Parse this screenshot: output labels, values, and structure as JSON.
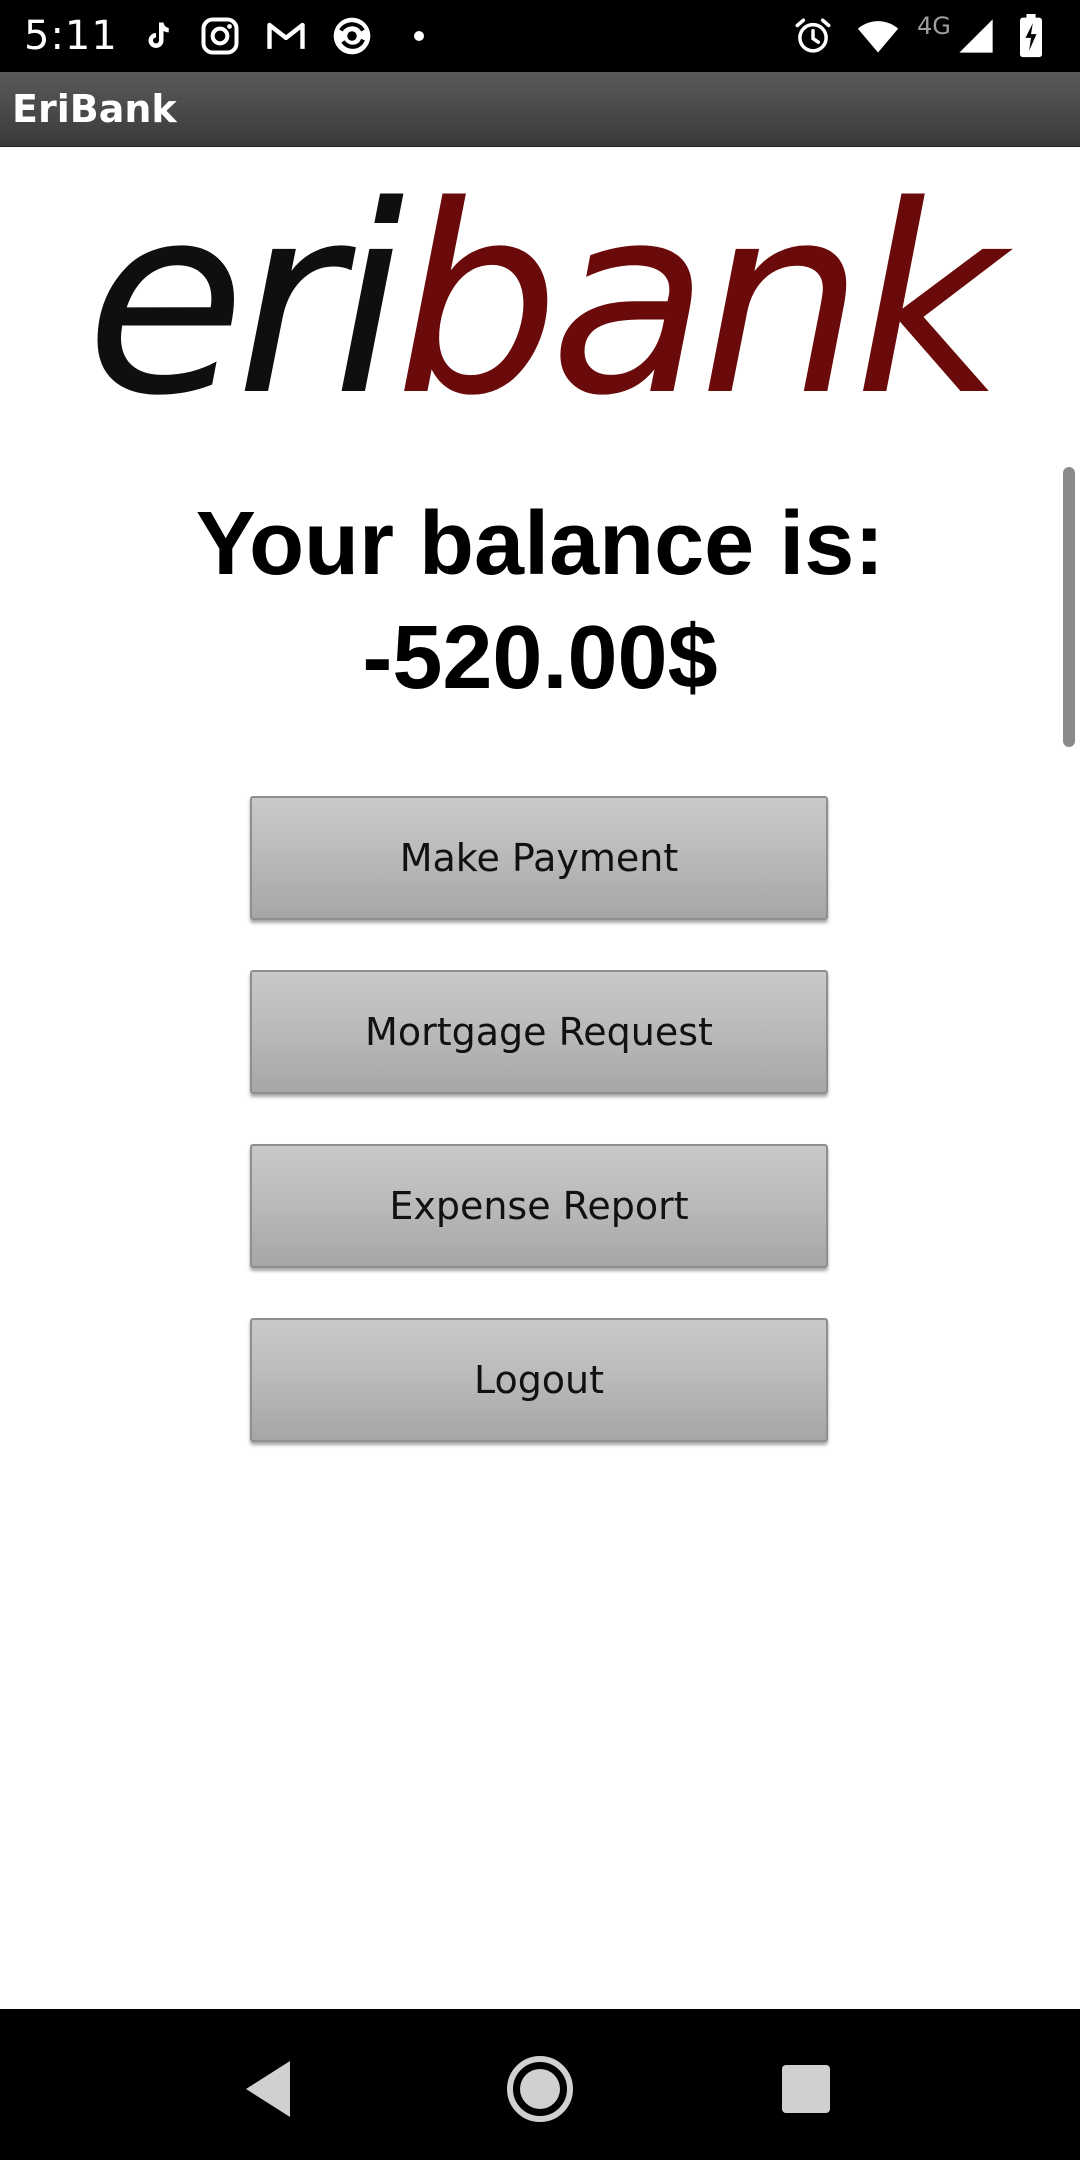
{
  "status_bar": {
    "time": "5:11",
    "network_label": "4G",
    "icons": [
      "tiktok-icon",
      "instagram-icon",
      "gmail-icon",
      "browser-icon",
      "notification-dot-icon",
      "alarm-icon",
      "wifi-icon",
      "signal-icon",
      "battery-charging-icon"
    ]
  },
  "action_bar": {
    "title": "EriBank"
  },
  "logo": {
    "part1": "eri",
    "part2": "bank",
    "colors": {
      "eri": "#0f0f0f",
      "bank": "#6b0a0a"
    }
  },
  "balance": {
    "label": "Your balance is:",
    "amount": "-520.00$"
  },
  "buttons": [
    {
      "label": "Make Payment"
    },
    {
      "label": "Mortgage Request"
    },
    {
      "label": "Expense Report"
    },
    {
      "label": "Logout"
    }
  ],
  "nav_bar": {
    "icons": [
      "back-icon",
      "home-icon",
      "recents-icon"
    ]
  }
}
